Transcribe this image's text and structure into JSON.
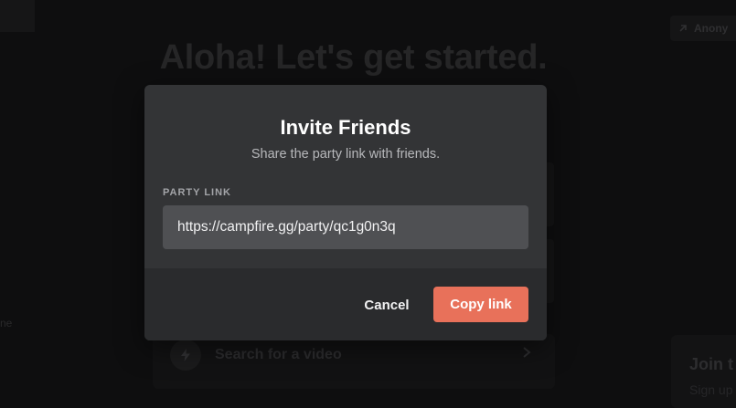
{
  "background": {
    "hero_title": "Aloha! Let's get started.",
    "anon_badge": "Anony",
    "left_text": "ne",
    "side_card": {
      "title": "Join t",
      "subtitle": "Sign up"
    },
    "search": {
      "label": "Search for a video",
      "icon": "lightning-icon"
    }
  },
  "modal": {
    "title": "Invite Friends",
    "subtitle": "Share the party link with friends.",
    "field_label": "PARTY LINK",
    "party_link": "https://campfire.gg/party/qc1g0n3q",
    "cancel_label": "Cancel",
    "copy_label": "Copy link"
  },
  "colors": {
    "accent": "#e8715a",
    "modal_bg": "#333436",
    "footer_bg": "#2a2b2d",
    "input_bg": "#4f5053"
  }
}
